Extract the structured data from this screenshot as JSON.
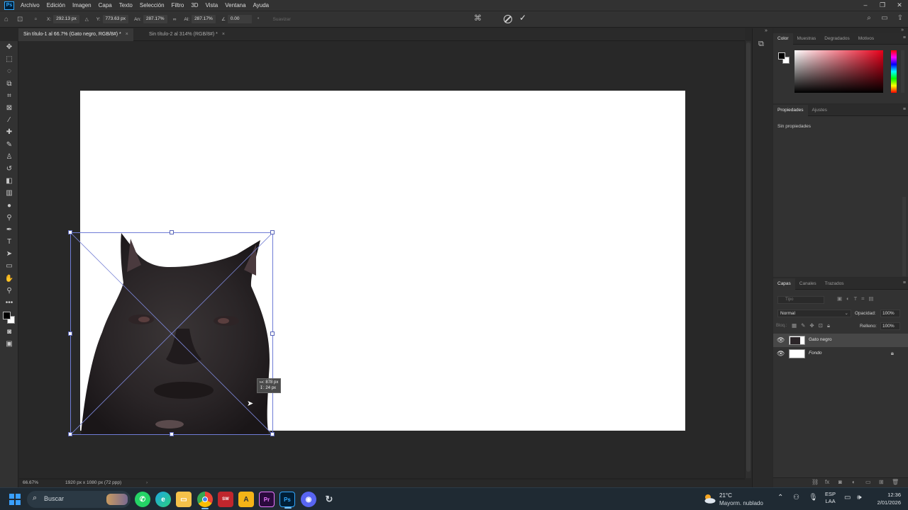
{
  "menu": {
    "items": [
      "Archivo",
      "Edición",
      "Imagen",
      "Capa",
      "Texto",
      "Selección",
      "Filtro",
      "3D",
      "Vista",
      "Ventana",
      "Ayuda"
    ]
  },
  "options_bar": {
    "x_label": "X:",
    "x_value": "292.13 px",
    "y_label": "Y:",
    "y_value": "773.63 px",
    "w_label": "An:",
    "w_value": "287.17%",
    "h_label": "Al:",
    "h_value": "287.17%",
    "angle_value": "0.00",
    "angle_unit": "°",
    "interp_label": "Suavizar"
  },
  "tabs": [
    {
      "label": "Sin título-1 al 66.7% (Gato negro, RGB/8#) *"
    },
    {
      "label": "Sin título-2 al 314% (RGB/8#) *"
    }
  ],
  "canvas": {
    "size_tip_w": "878 px",
    "size_tip_h": "24 px"
  },
  "status": {
    "zoom": "66.67%",
    "doc_info": "1920 px x 1080 px (72 ppp)"
  },
  "color_panel": {
    "tabs": [
      "Color",
      "Muestras",
      "Degradados",
      "Motivos"
    ],
    "foreground": "#000000",
    "background": "#ffffff",
    "hue": "#e8001a"
  },
  "props_panel": {
    "tabs": [
      "Propiedades",
      "Ajustes"
    ],
    "empty_text": "Sin propiedades"
  },
  "layers_panel": {
    "tabs": [
      "Capas",
      "Canales",
      "Trazados"
    ],
    "search_placeholder": "Tipo",
    "blend_mode": "Normal",
    "opacity_label": "Opacidad:",
    "opacity_value": "100%",
    "lock_label": "Bloq.:",
    "fill_label": "Relleno:",
    "fill_value": "100%",
    "layers": [
      {
        "name": "Gato negro",
        "selected": true
      },
      {
        "name": "Fondo",
        "selected": false
      }
    ]
  },
  "taskbar": {
    "search_label": "Buscar",
    "weather_temp": "21°C",
    "weather_cond": "Mayorm. nublado",
    "lang_top": "ESP",
    "lang_bottom": "LAA",
    "time": "12:36",
    "date": "2/01/2026",
    "apps": [
      "whatsapp",
      "edge",
      "file-explorer",
      "chrome",
      "sw-2024",
      "illustrator-like",
      "premiere",
      "photoshop",
      "discord",
      "refresh-app"
    ]
  }
}
